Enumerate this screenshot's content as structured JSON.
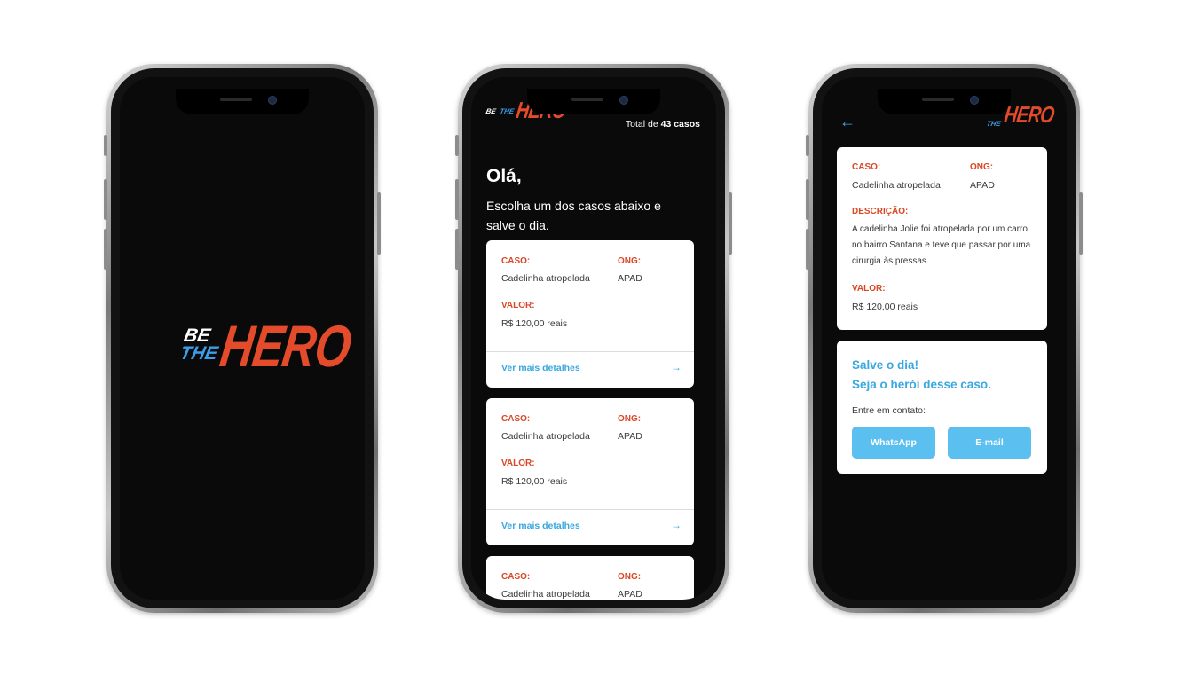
{
  "brand": {
    "be": "BE",
    "the": "THE",
    "hero": "HERO"
  },
  "list": {
    "total_prefix": "Total de ",
    "total_count": "43 casos",
    "greeting": "Olá,",
    "subtitle": "Escolha um dos casos abaixo e salve o dia.",
    "cards": [
      {
        "case_label": "CASO:",
        "case_value": "Cadelinha atropelada",
        "ong_label": "ONG:",
        "ong_value": "APAD",
        "value_label": "VALOR:",
        "value": "R$ 120,00 reais",
        "details_link": "Ver mais detalhes",
        "arrow_icon": "arrow-right-icon"
      },
      {
        "case_label": "CASO:",
        "case_value": "Cadelinha atropelada",
        "ong_label": "ONG:",
        "ong_value": "APAD",
        "value_label": "VALOR:",
        "value": "R$ 120,00 reais",
        "details_link": "Ver mais detalhes",
        "arrow_icon": "arrow-right-icon"
      },
      {
        "case_label": "CASO:",
        "case_value": "Cadelinha atropelada",
        "ong_label": "ONG:",
        "ong_value": "APAD"
      }
    ]
  },
  "detail": {
    "back_icon": "arrow-left-icon",
    "case_label": "CASO:",
    "case_value": "Cadelinha atropelada",
    "ong_label": "ONG:",
    "ong_value": "APAD",
    "description_label": "DESCRIÇÃO:",
    "description": "A cadelinha Jolie foi atropelada por um carro no bairro Santana e teve que passar por uma cirurgia às pressas.",
    "value_label": "VALOR:",
    "value": "R$ 120,00 reais",
    "cta_line1": "Salve o dia!",
    "cta_line2": "Seja o herói desse caso.",
    "contact_prompt": "Entre em contato:",
    "whatsapp_button": "WhatsApp",
    "email_button": "E-mail"
  },
  "colors": {
    "accent_red": "#e44b2b",
    "accent_blue": "#3aa8e0",
    "button_blue": "#5bc0f0",
    "screen_bg": "#0a0a0a"
  }
}
